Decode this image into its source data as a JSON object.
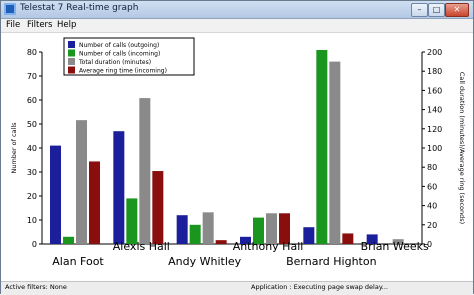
{
  "window": {
    "title": "Telestat 7 Real-time graph"
  },
  "menu": [
    "File",
    "Filters",
    "Help"
  ],
  "status": {
    "left": "Active filters: None",
    "right": "Application : Executing page swap delay..."
  },
  "colors": {
    "outgoing": "#1b1f9c",
    "incoming": "#1a961f",
    "duration": "#8a8a8a",
    "ring": "#8b0e0e"
  },
  "chart_data": {
    "type": "bar",
    "categories": [
      "Alan Foot",
      "Alexis Hall",
      "Andy Whitley",
      "Anthony Hall",
      "Bernard Highton",
      "Brian Weeks"
    ],
    "ylabel": "Number of calls",
    "y2label": "Call duration (minutes)/Average ring (seconds)",
    "ylim": [
      0,
      80
    ],
    "y2lim": [
      0,
      200
    ],
    "yticks": [
      0,
      10,
      20,
      30,
      40,
      50,
      60,
      70,
      80
    ],
    "y2ticks": [
      0,
      20,
      40,
      60,
      80,
      100,
      120,
      140,
      160,
      180,
      200
    ],
    "legend_position": "top-left",
    "grid": false,
    "series": [
      {
        "name": "Number of calls (outgoing)",
        "axis": "left",
        "values": [
          41,
          47,
          12,
          3,
          7,
          4
        ]
      },
      {
        "name": "Number of calls (incoming)",
        "axis": "left",
        "values": [
          3,
          19,
          8,
          11,
          81,
          0
        ]
      },
      {
        "name": "Total duration (minutes)",
        "axis": "right",
        "values": [
          129,
          152,
          33,
          32,
          190,
          5
        ]
      },
      {
        "name": "Average ring time (incoming)",
        "axis": "right",
        "values": [
          86,
          76,
          4,
          32,
          11,
          0
        ]
      }
    ]
  }
}
